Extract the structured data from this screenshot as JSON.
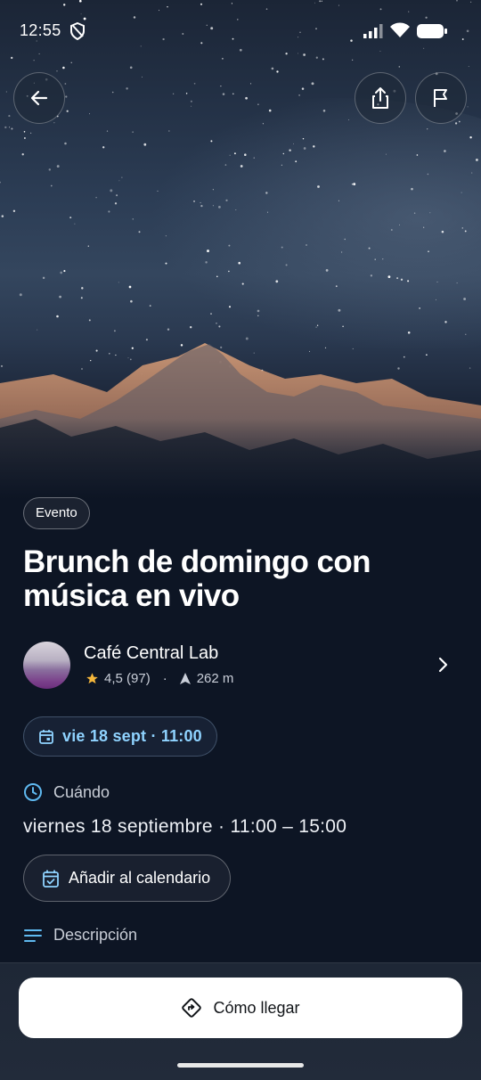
{
  "status_bar": {
    "time": "12:55"
  },
  "event": {
    "type_label": "Evento",
    "title": "Brunch de domingo con música en vivo"
  },
  "venue": {
    "name": "Café Central Lab",
    "rating": "4,5 (97)",
    "separator": "·",
    "distance": "262 m"
  },
  "date_chip": {
    "label": "vie 18 sept · 11:00"
  },
  "when": {
    "heading": "Cuándo",
    "text": "viernes 18 septiembre · 11:00 – 15:00",
    "add_calendar_label": "Añadir al calendario"
  },
  "description": {
    "heading": "Descripción"
  },
  "cta": {
    "label": "Cómo llegar"
  },
  "colors": {
    "background": "#0d1524",
    "accent": "#8fd3ff",
    "star": "#f5b73b",
    "cta_bg": "#ffffff"
  },
  "icons": [
    "shield-icon",
    "signal-icon",
    "wifi-icon",
    "battery-icon",
    "back-arrow-icon",
    "share-icon",
    "flag-icon",
    "star-icon",
    "navigation-arrow-icon",
    "chevron-right-icon",
    "calendar-icon",
    "clock-icon",
    "calendar-check-icon",
    "lines-icon",
    "directions-icon"
  ]
}
